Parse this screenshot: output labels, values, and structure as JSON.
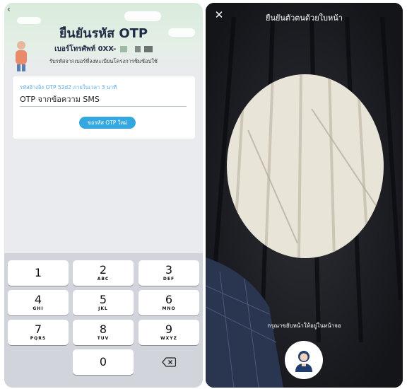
{
  "left_screen": {
    "back_icon": "chevron-left-icon",
    "title": "ยืนยันรหัส OTP",
    "phone_label": "เบอร์โทรศัพท์ 0XX-",
    "subtext": "รับรหัสจากเบอร์ที่ลงทะเบียนโครงการชิมช้อปใช้",
    "otp_ref": "รหัสอ้างอิง OTP 52d2 ภายในเวลา 3 นาที",
    "otp_placeholder": "OTP จากข้อความ SMS",
    "resend_label": "ขอรหัส OTP ใหม่",
    "keypad": {
      "keys": [
        {
          "num": "1",
          "sub": ""
        },
        {
          "num": "2",
          "sub": "ABC"
        },
        {
          "num": "3",
          "sub": "DEF"
        },
        {
          "num": "4",
          "sub": "GHI"
        },
        {
          "num": "5",
          "sub": "JKL"
        },
        {
          "num": "6",
          "sub": "MNO"
        },
        {
          "num": "7",
          "sub": "PQRS"
        },
        {
          "num": "8",
          "sub": "TUV"
        },
        {
          "num": "9",
          "sub": "WXYZ"
        },
        {
          "num": "0",
          "sub": ""
        }
      ],
      "delete_icon": "backspace-icon"
    }
  },
  "right_screen": {
    "title": "ยืนยันตัวตนด้วยใบหน้า",
    "close_label": "✕",
    "instruction": "กรุณาขยับหน้าให้อยู่ในหน้าจอ",
    "shutter_icon": "face-avatar-icon"
  },
  "colors": {
    "accent_blue": "#35a7e0",
    "ref_text_blue": "#5aa9e6",
    "title_navy": "#1f2a44",
    "keypad_bg": "#d1d5db",
    "camera_bg": "#1c1d22"
  }
}
